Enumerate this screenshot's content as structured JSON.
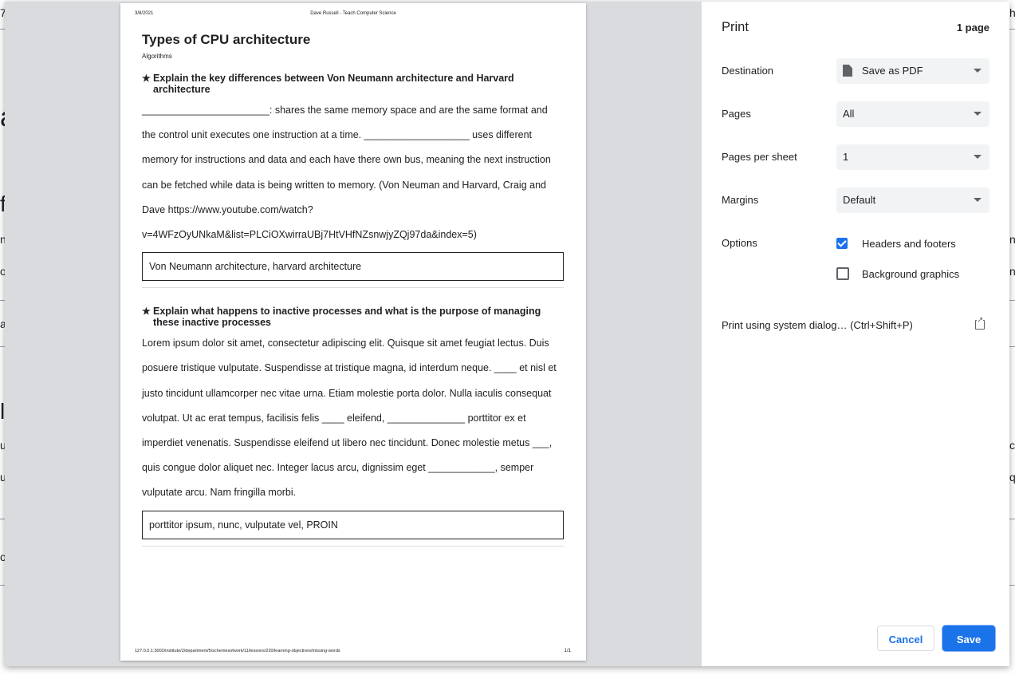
{
  "background": {
    "fragments": [
      "7.",
      "a",
      "fe",
      "n",
      "o",
      "a",
      "le",
      "u",
      "u",
      "o",
      "h",
      "nc",
      "n",
      "c",
      "q"
    ]
  },
  "document": {
    "header_date": "3/8/2021",
    "header_site": "Dave Russell - Teach Computer Science",
    "title": "Types of CPU architecture",
    "subtitle": "Algorithms",
    "questions": [
      {
        "title": "Explain the key differences between Von Neumann architecture and Harvard architecture",
        "text": "_______________________: shares the same memory space and are the same format and the control unit executes one instruction at a time. ___________________ uses different memory for instructions and data and each have there own bus, meaning the next instruction can be fetched while data is being written to memory. (Von Neuman and Harvard, Craig and Dave https://www.youtube.com/watch?v=4WFzOyUNkaM&list=PLCiOXwirraUBj7HtVHfNZsnwjyZQj97da&index=5)",
        "answer": "Von Neumann architecture, harvard architecture"
      },
      {
        "title": "Explain what happens to inactive processes and what is the purpose of managing these inactive processes",
        "text": "Lorem ipsum dolor sit amet, consectetur adipiscing elit. Quisque sit amet feugiat lectus. Duis posuere tristique vulputate. Suspendisse at tristique magna, id interdum neque. ____ et nisl et justo tincidunt ullamcorper nec vitae urna. Etiam molestie porta dolor. Nulla iaculis consequat volutpat. Ut ac erat tempus, facilisis felis ____ eleifend, ______________ porttitor ex et imperdiet venenatis. Suspendisse eleifend ut libero nec tincidunt. Donec molestie metus ___, quis congue dolor aliquet nec. Integer lacus arcu, dignissim eget ____________, semper vulputate arcu. Nam fringilla morbi.",
        "answer": "porttitor ipsum, nunc, vulputate vel, PROIN"
      }
    ],
    "footer_url": "127.0.0.1:3002/institute/2/department/5/schemesofwork/11/lessons/220/learning-objectives/missing-words",
    "footer_page": "1/1"
  },
  "settings": {
    "title": "Print",
    "page_count": "1 page",
    "destination_label": "Destination",
    "destination_value": "Save as PDF",
    "pages_label": "Pages",
    "pages_value": "All",
    "pps_label": "Pages per sheet",
    "pps_value": "1",
    "margins_label": "Margins",
    "margins_value": "Default",
    "options_label": "Options",
    "opt_headers": "Headers and footers",
    "opt_bg": "Background graphics",
    "system_dialog": "Print using system dialog… (Ctrl+Shift+P)",
    "cancel": "Cancel",
    "save": "Save"
  },
  "colors": {
    "accent": "#1a73e8",
    "preview_bg": "#d9dbde"
  }
}
